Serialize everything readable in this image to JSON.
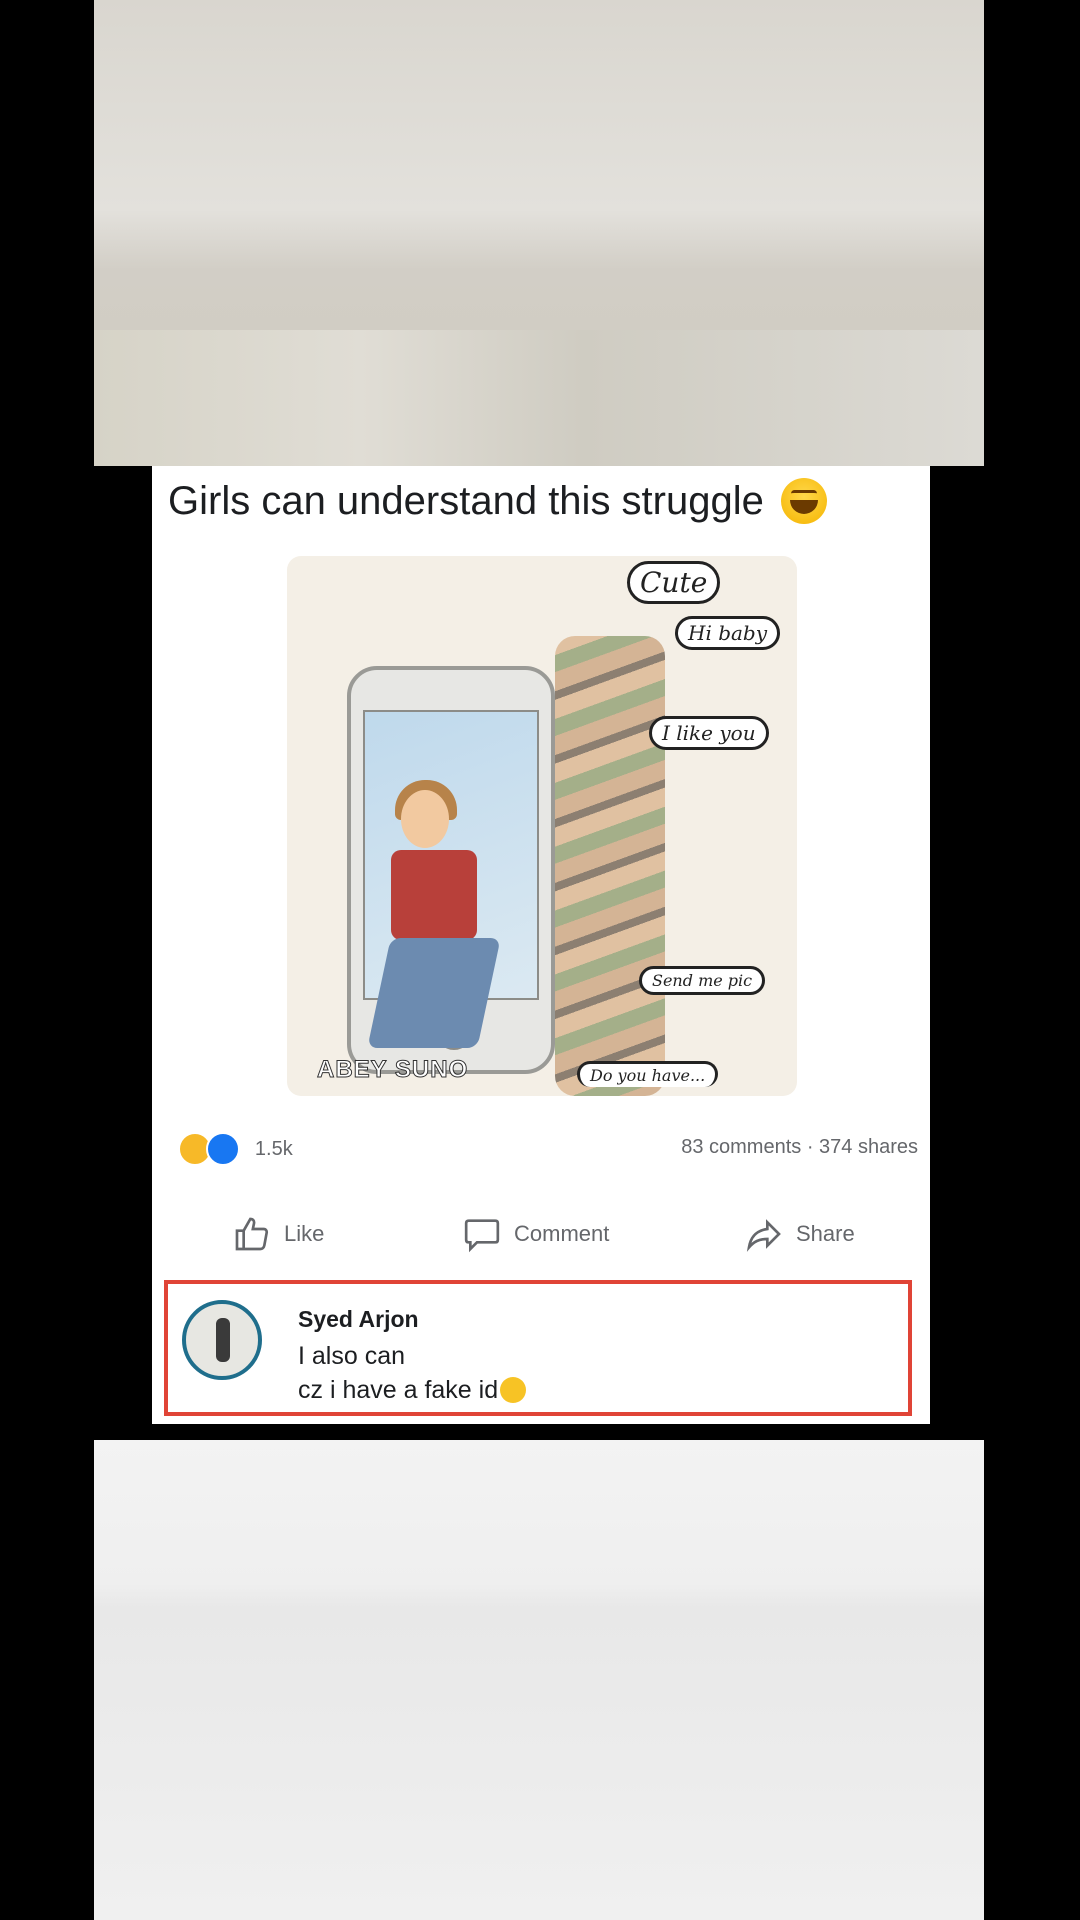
{
  "post": {
    "title": "Girls can understand this struggle",
    "title_emoji": "laughing-emoji"
  },
  "illustration": {
    "bubbles": {
      "cute": "Cute",
      "hi_baby": "Hi baby",
      "like_you": "I like you",
      "send_pic": "Send me pic",
      "do_you": "Do you have..."
    },
    "watermark": "ABEY SUNO"
  },
  "stats": {
    "reaction_count": "1.5k",
    "comments_shares": "83 comments · 374 shares"
  },
  "actions": {
    "like": "Like",
    "comment": "Comment",
    "share": "Share"
  },
  "comment": {
    "author": "Syed Arjon",
    "line1": "I also can",
    "line2": "cz i have a fake id",
    "highlight_color": "#e04436"
  }
}
